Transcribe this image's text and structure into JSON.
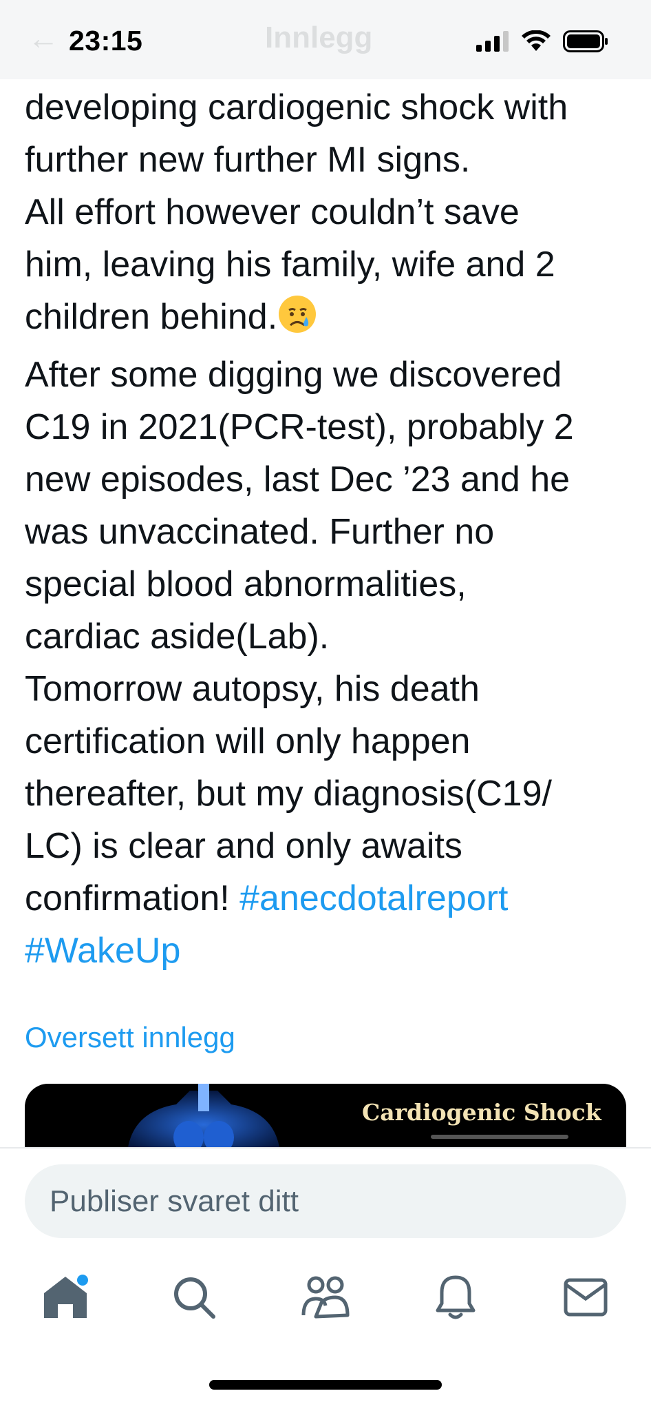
{
  "status_bar": {
    "time": "23:15"
  },
  "header": {
    "title": "Innlegg"
  },
  "post": {
    "lines": [
      "developing cardiogenic shock with",
      "further new further MI signs.",
      "All effort however couldn’t save",
      "him, leaving his family, wife and 2",
      "children behind.",
      "After some digging we discovered",
      "C19 in 2021(PCR-test), probably 2",
      "new episodes, last Dec ’23 and he",
      "was unvaccinated. Further no",
      "special blood abnormalities,",
      "cardiac aside(Lab).",
      "Tomorrow autopsy, his death",
      "certification will only happen",
      "thereafter, but my diagnosis(C19/",
      "LC) is clear and only awaits",
      "confirmation!"
    ],
    "emoji": "crying-face",
    "hashtags": [
      "#anecdotalreport",
      "#WakeUp"
    ]
  },
  "translate_link": "Oversett innlegg",
  "media": {
    "title": "Cardiogenic Shock"
  },
  "reply": {
    "placeholder": "Publiser svaret ditt"
  },
  "nav": {
    "items": [
      "home-icon",
      "search-icon",
      "communities-icon",
      "notifications-icon",
      "messages-icon"
    ],
    "home_has_badge": true
  },
  "colors": {
    "accent": "#1d9bf0",
    "text": "#0f1419",
    "muted": "#536471",
    "input_bg": "#eff3f4"
  }
}
